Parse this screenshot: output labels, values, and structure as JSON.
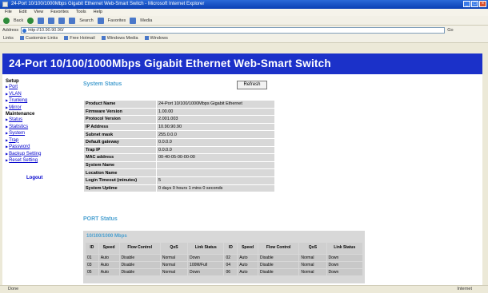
{
  "window": {
    "title": "24-Port 10/100/1000Mbps Gigabit Ethernet Web-Smart Switch - Microsoft Internet Explorer"
  },
  "menubar": {
    "items": [
      "File",
      "Edit",
      "View",
      "Favorites",
      "Tools",
      "Help"
    ]
  },
  "toolbar": {
    "back_label": "Back",
    "search_label": "Search",
    "favorites_label": "Favorites",
    "media_label": "Media"
  },
  "addressbar": {
    "label": "Address",
    "url": "http://10.90.90.90/",
    "go_label": "Go"
  },
  "linksbar": {
    "items": [
      "Links",
      "Customize Links",
      "Free Hotmail",
      "Windows Media",
      "Windows"
    ]
  },
  "banner": {
    "title": "24-Port 10/100/1000Mbps Gigabit Ethernet Web-Smart Switch"
  },
  "sidebar": {
    "setup_label": "Setup",
    "setup_items": [
      "Port",
      "VLAN",
      "Trunking",
      "Mirror"
    ],
    "maintenance_label": "Maintenance",
    "maintenance_items": [
      "Status",
      "Statistics",
      "System",
      "Trap",
      "Password",
      "Backup Setting",
      "Reset Setting"
    ],
    "logout_label": "Logout"
  },
  "main": {
    "status_heading": "System Status",
    "refresh_label": "Refresh",
    "info": [
      {
        "key": "Product Name",
        "value": "24-Port 10/100/1000Mbps Gigabit Ethernet"
      },
      {
        "key": "Firmware Version",
        "value": "1.00.00"
      },
      {
        "key": "Protocol Version",
        "value": "2.001.003"
      },
      {
        "key": "IP Address",
        "value": "10.90.90.90"
      },
      {
        "key": "Subnet mask",
        "value": "255.0.0.0"
      },
      {
        "key": "Default gateway",
        "value": "0.0.0.0"
      },
      {
        "key": "Trap IP",
        "value": "0.0.0.0"
      },
      {
        "key": "MAC address",
        "value": "00-40-05-00-00-00"
      },
      {
        "key": "System Name",
        "value": ""
      },
      {
        "key": "Location Name",
        "value": ""
      },
      {
        "key": "Login Timeout (minutes)",
        "value": "5"
      },
      {
        "key": "System Uptime",
        "value": "0 days 0 hours 1 mins 0 seconds"
      }
    ],
    "port_heading": "PORT Status",
    "port_caption": "10/100/1000 Mbps",
    "port_headers": [
      "ID",
      "Speed",
      "Flow Control",
      "QoS",
      "Link Status",
      "ID",
      "Speed",
      "Flow Control",
      "QoS",
      "Link Status"
    ],
    "port_rows": [
      [
        "01",
        "Auto",
        "Disable",
        "Normal",
        "Down",
        "02",
        "Auto",
        "Disable",
        "Normal",
        "Down"
      ],
      [
        "03",
        "Auto",
        "Disable",
        "Normal",
        "100M/Full",
        "04",
        "Auto",
        "Disable",
        "Normal",
        "Down"
      ],
      [
        "05",
        "Auto",
        "Disable",
        "Normal",
        "Down",
        "06",
        "Auto",
        "Disable",
        "Normal",
        "Down"
      ]
    ]
  },
  "statusbar": {
    "left": "Done",
    "zone": "Internet"
  }
}
